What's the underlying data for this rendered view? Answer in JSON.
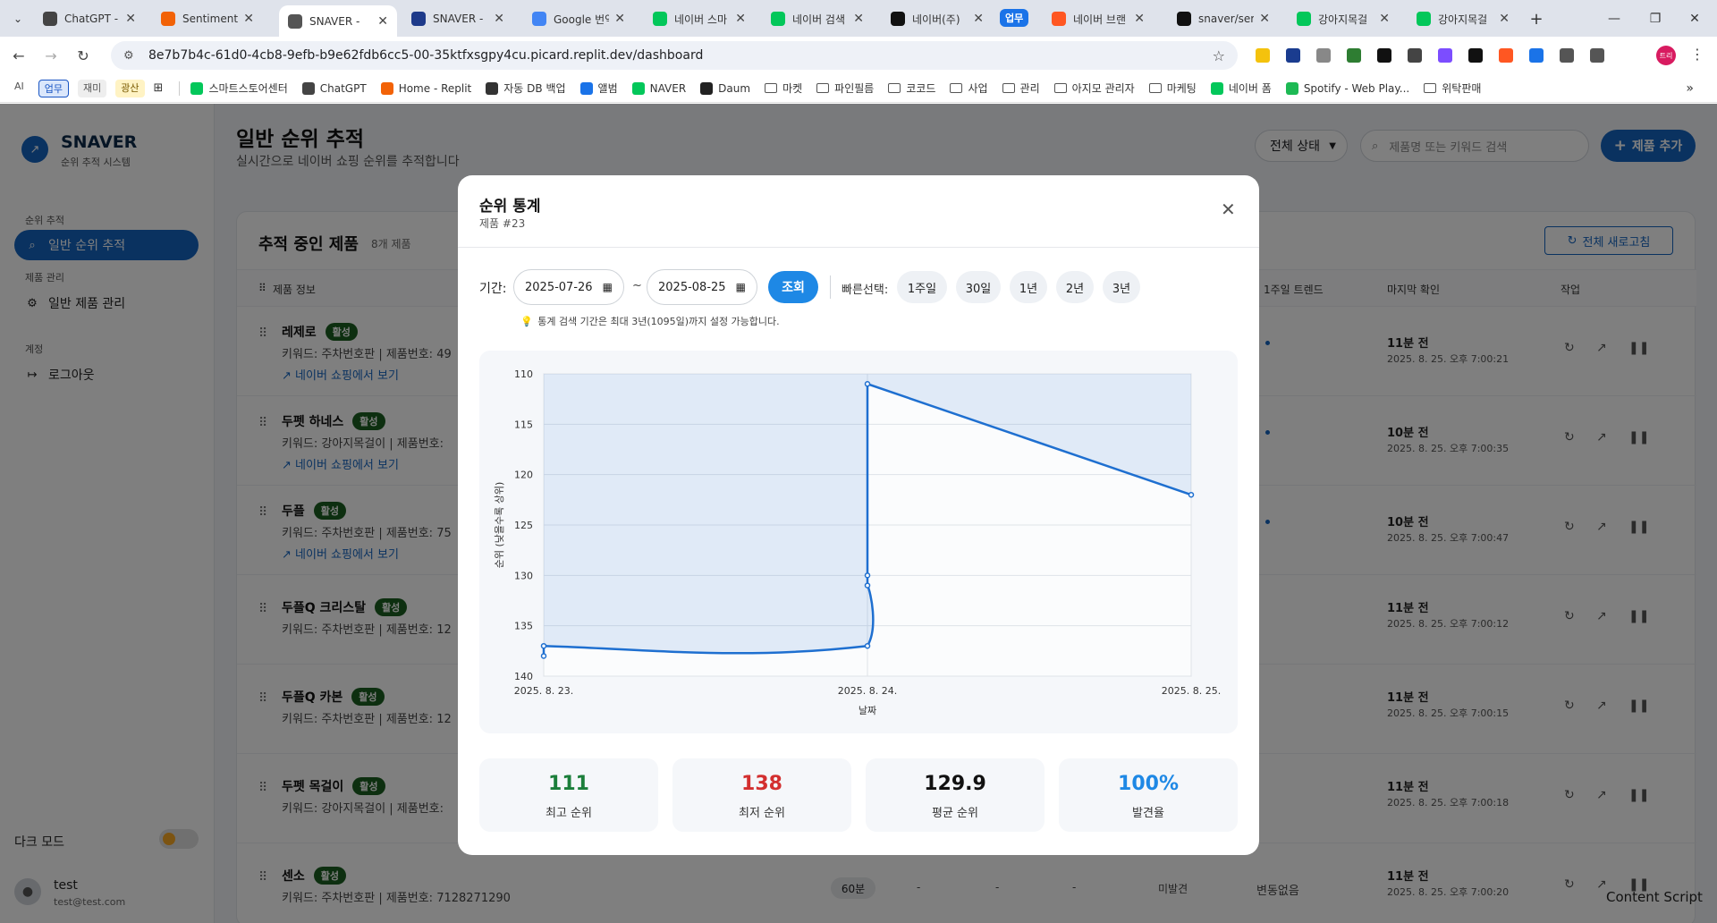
{
  "browser": {
    "tabs": [
      {
        "title": "ChatGPT - ",
        "favicon": "chatgpt-icon",
        "color": "#444444"
      },
      {
        "title": "SentimentS",
        "favicon": "replit-icon",
        "color": "#f26207"
      },
      {
        "title": "SNAVER - ",
        "favicon": "globe-icon",
        "color": "#555555"
      },
      {
        "title": "SNAVER - ",
        "favicon": "ps-icon",
        "color": "#1e3a8a"
      },
      {
        "title": "Google 번역",
        "favicon": "google-translate-icon",
        "color": "#4285f4"
      },
      {
        "title": "네이버 스마",
        "favicon": "smartstore-icon",
        "color": "#03c75a"
      },
      {
        "title": "네이버 검색",
        "favicon": "naver-icon",
        "color": "#03c75a"
      },
      {
        "title": "네이버(주)",
        "favicon": "naver-corp-icon",
        "color": "#111111"
      },
      {
        "title": "네이버 브랜",
        "favicon": "brand-icon",
        "color": "#ff5722"
      },
      {
        "title": "snaver/serv",
        "favicon": "github-icon",
        "color": "#111111"
      },
      {
        "title": "강아지목걸",
        "favicon": "naver-icon",
        "color": "#03c75a"
      },
      {
        "title": "강아지목걸",
        "favicon": "naver-icon",
        "color": "#03c75a"
      }
    ],
    "group_label": "업무",
    "url": "8e7b7b4c-61d0-4cb8-9efb-b9e62fdb6cc5-00-35ktfxsgpy4cu.picard.replit.dev/dashboard",
    "profile_label": "트리",
    "bookmark_chips": [
      "AI",
      "업무",
      "재미",
      "광산"
    ],
    "bookmarks": [
      {
        "label": "스마트스토어센터",
        "icon": "smartstore-icon"
      },
      {
        "label": "ChatGPT",
        "icon": "chatgpt-icon"
      },
      {
        "label": "Home - Replit",
        "icon": "replit-icon"
      },
      {
        "label": "자동 DB 백업",
        "icon": "db-icon"
      },
      {
        "label": "앨범",
        "icon": "album-icon"
      },
      {
        "label": "NAVER",
        "icon": "naver-icon"
      },
      {
        "label": "Daum",
        "icon": "daum-icon"
      },
      {
        "label": "마켓",
        "icon": "folder-icon"
      },
      {
        "label": "파인필름",
        "icon": "folder-icon"
      },
      {
        "label": "코코드",
        "icon": "folder-icon"
      },
      {
        "label": "사업",
        "icon": "folder-icon"
      },
      {
        "label": "관리",
        "icon": "folder-icon"
      },
      {
        "label": "아지모 관리자",
        "icon": "folder-icon"
      },
      {
        "label": "마케팅",
        "icon": "folder-icon"
      },
      {
        "label": "네이버 폼",
        "icon": "naver-form-icon"
      },
      {
        "label": "Spotify - Web Play...",
        "icon": "spotify-icon"
      },
      {
        "label": "위탁판매",
        "icon": "folder-icon"
      }
    ]
  },
  "app": {
    "logo_title": "SNAVER",
    "logo_sub": "순위 추적 시스템",
    "section_rank": "순위 추적",
    "nav_rank": "일반 순위 추적",
    "section_product": "제품 관리",
    "nav_product": "일반 제품 관리",
    "section_account": "계정",
    "nav_logout": "로그아웃",
    "dark_mode": "다크 모드",
    "user_name": "test",
    "user_email": "test@test.com",
    "page_title": "일반 순위 추적",
    "page_sub": "실시간으로 네이버 쇼핑 순위를 추적합니다",
    "status_filter": "전체 상태",
    "search_placeholder": "제품명 또는 키워드 검색",
    "add_button": "제품 추가",
    "card_title": "추적 중인 제품",
    "card_count": "8개 제품",
    "refresh_all": "전체 새로고침",
    "columns": {
      "info": "제품 정보",
      "trend": "1주일 트렌드",
      "last": "마지막 확인",
      "actions": "작업"
    },
    "link_text": "네이버 쇼핑에서 보기",
    "products": [
      {
        "name": "레제로",
        "status": "활성",
        "keyword": "키워드: 주차번호판 | 제품번호: 49",
        "has_link": true,
        "last_rel": "11분 전",
        "last_abs": "2025. 8. 25. 오후 7:00:21"
      },
      {
        "name": "두펫 하네스",
        "status": "활성",
        "keyword": "키워드: 강아지목걸이 | 제품번호:",
        "has_link": true,
        "last_rel": "10분 전",
        "last_abs": "2025. 8. 25. 오후 7:00:35"
      },
      {
        "name": "두플",
        "status": "활성",
        "keyword": "키워드: 주차번호판 | 제품번호: 75",
        "has_link": true,
        "last_rel": "10분 전",
        "last_abs": "2025. 8. 25. 오후 7:00:47"
      },
      {
        "name": "두플Q 크리스탈",
        "status": "활성",
        "keyword": "키워드: 주차번호판 | 제품번호: 12",
        "has_link": false,
        "last_rel": "11분 전",
        "last_abs": "2025. 8. 25. 오후 7:00:12"
      },
      {
        "name": "두플Q 카본",
        "status": "활성",
        "keyword": "키워드: 주차번호판 | 제품번호: 12",
        "has_link": false,
        "last_rel": "11분 전",
        "last_abs": "2025. 8. 25. 오후 7:00:15"
      },
      {
        "name": "두펫 목걸이",
        "status": "활성",
        "keyword": "키워드: 강아지목걸이 | 제품번호:",
        "has_link": false,
        "last_rel": "11분 전",
        "last_abs": "2025. 8. 25. 오후 7:00:18"
      },
      {
        "name": "센소",
        "status": "활성",
        "keyword": "키워드: 주차번호판 | 제품번호: 7128271290",
        "has_link": false,
        "last_rel": "11분 전",
        "last_abs": "2025. 8. 25. 오후 7:00:20",
        "interval": "60분",
        "dash": "-",
        "found": "미발견",
        "change": "변동없음"
      }
    ]
  },
  "modal": {
    "title": "순위 통계",
    "subtitle": "제품 #23",
    "period_label": "기간:",
    "start_date": "2025-07-26",
    "end_date": "2025-08-25",
    "tilde": "~",
    "query_button": "조회",
    "quick_label": "빠른선택:",
    "quick_options": [
      "1주일",
      "30일",
      "1년",
      "2년",
      "3년"
    ],
    "hint": "통계 검색 기간은 최대 3년(1095일)까지 설정 가능합니다.",
    "stats": [
      {
        "value": "111",
        "label": "최고 순위",
        "color": "#1b7e3a"
      },
      {
        "value": "138",
        "label": "최저 순위",
        "color": "#d32f2f"
      },
      {
        "value": "129.9",
        "label": "평균 순위",
        "color": "#111111"
      },
      {
        "value": "100%",
        "label": "발견율",
        "color": "#1e88e5"
      }
    ]
  },
  "chart_data": {
    "type": "line",
    "ylabel": "순위 (낮을수록 상위)",
    "xlabel": "날짜",
    "x_ticks": [
      "2025. 8. 23.",
      "2025. 8. 24.",
      "2025. 8. 25."
    ],
    "y_ticks": [
      110,
      115,
      120,
      125,
      130,
      135,
      140
    ],
    "ylim": [
      110,
      140
    ],
    "y_reversed": true,
    "x_range_days": [
      0,
      2
    ],
    "grid": true,
    "fill": true,
    "line_color": "#1e6fd0",
    "points": [
      {
        "day": 0.0,
        "rank": 138
      },
      {
        "day": 0.0,
        "rank": 137
      },
      {
        "day": 1.0,
        "rank": 137
      },
      {
        "day": 1.0,
        "rank": 131
      },
      {
        "day": 1.0,
        "rank": 130
      },
      {
        "day": 1.0,
        "rank": 111
      },
      {
        "day": 2.0,
        "rank": 122
      }
    ],
    "content_script_label": "Content Script"
  }
}
